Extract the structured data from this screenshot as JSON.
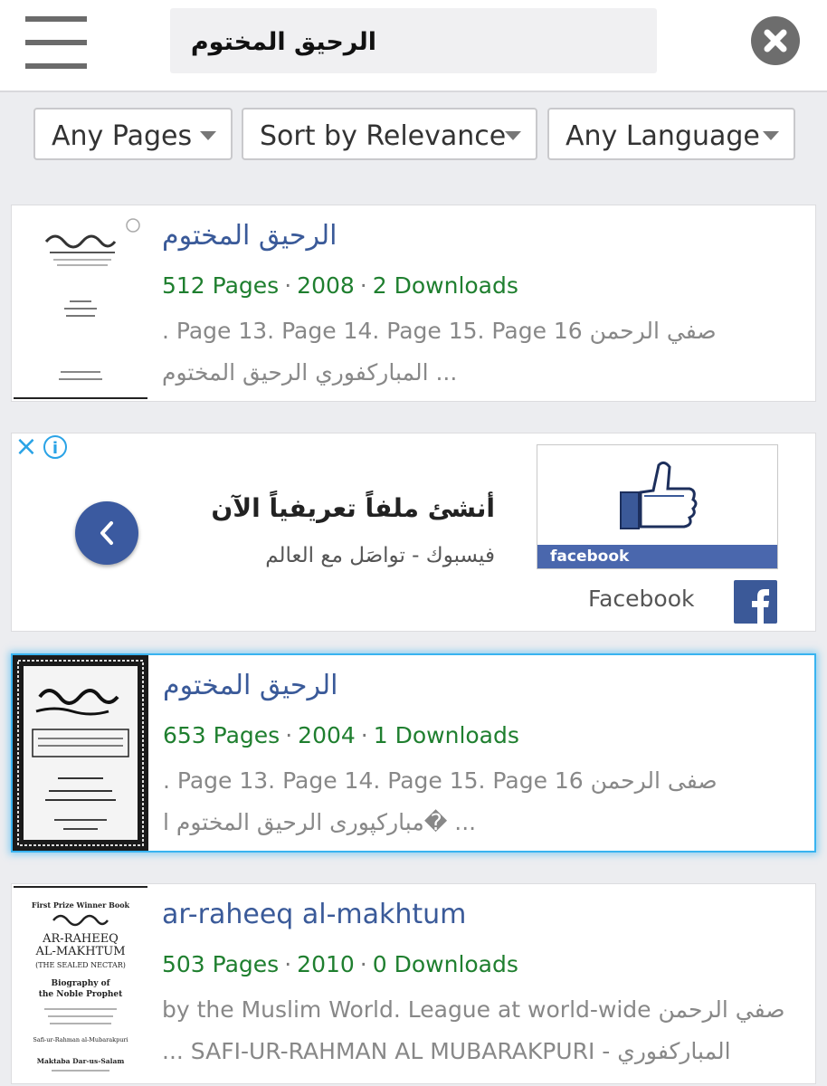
{
  "search": {
    "query": "الرحيق المختوم"
  },
  "filters": [
    {
      "label": "Any Pages"
    },
    {
      "label": "Sort by Relevance"
    },
    {
      "label": "Any Language"
    }
  ],
  "results": [
    {
      "title": "الرحيق المختوم",
      "pages": "512 Pages",
      "year": "2008",
      "downloads": "2 Downloads",
      "snippet_line1": "صفي الرحمن  Page 13. Page 14. Page 15. Page 16 .",
      "snippet_line2": "... المباركفوري الرحيق المختوم"
    },
    {
      "title": "الرحيق المختوم",
      "pages": "653 Pages",
      "year": "2004",
      "downloads": "1 Downloads",
      "snippet_line1": "صفى الرحمن  Page 13. Page 14. Page 15. Page 16 .",
      "snippet_line2": "... �مبارکپوری الرحیق المختوم ا"
    },
    {
      "title": "ar-raheeq al-makhtum",
      "pages": "503 Pages",
      "year": "2010",
      "downloads": "0 Downloads",
      "snippet_line1": "صفي الرحمن  by the Muslim World. League at world-wide",
      "snippet_line2": "المباركفوري - SAFI-UR-RAHMAN AL MUBARAKPURI ..."
    }
  ],
  "ad": {
    "headline": "أنشئ ملفاً تعريفياً الآن",
    "subtext": "فيسبوك - تواصَل مع العالم",
    "brand": "Facebook",
    "image_caption": "facebook"
  },
  "thumbnails": {
    "third_lines": [
      "First Prize Winner Book",
      "AR-RAHEEQ",
      "AL-MAKHTUM",
      "(THE SEALED NECTAR)",
      "Biography of",
      "the Noble Prophet",
      "Safi-ur-Rahman al-Mubarakpuri",
      "Maktaba Dar-us-Salam"
    ]
  },
  "colors": {
    "link": "#3a5a99",
    "meta": "#1f7f2f",
    "snippet": "#888888",
    "highlight": "#38b3f0",
    "facebook": "#3b5998"
  }
}
